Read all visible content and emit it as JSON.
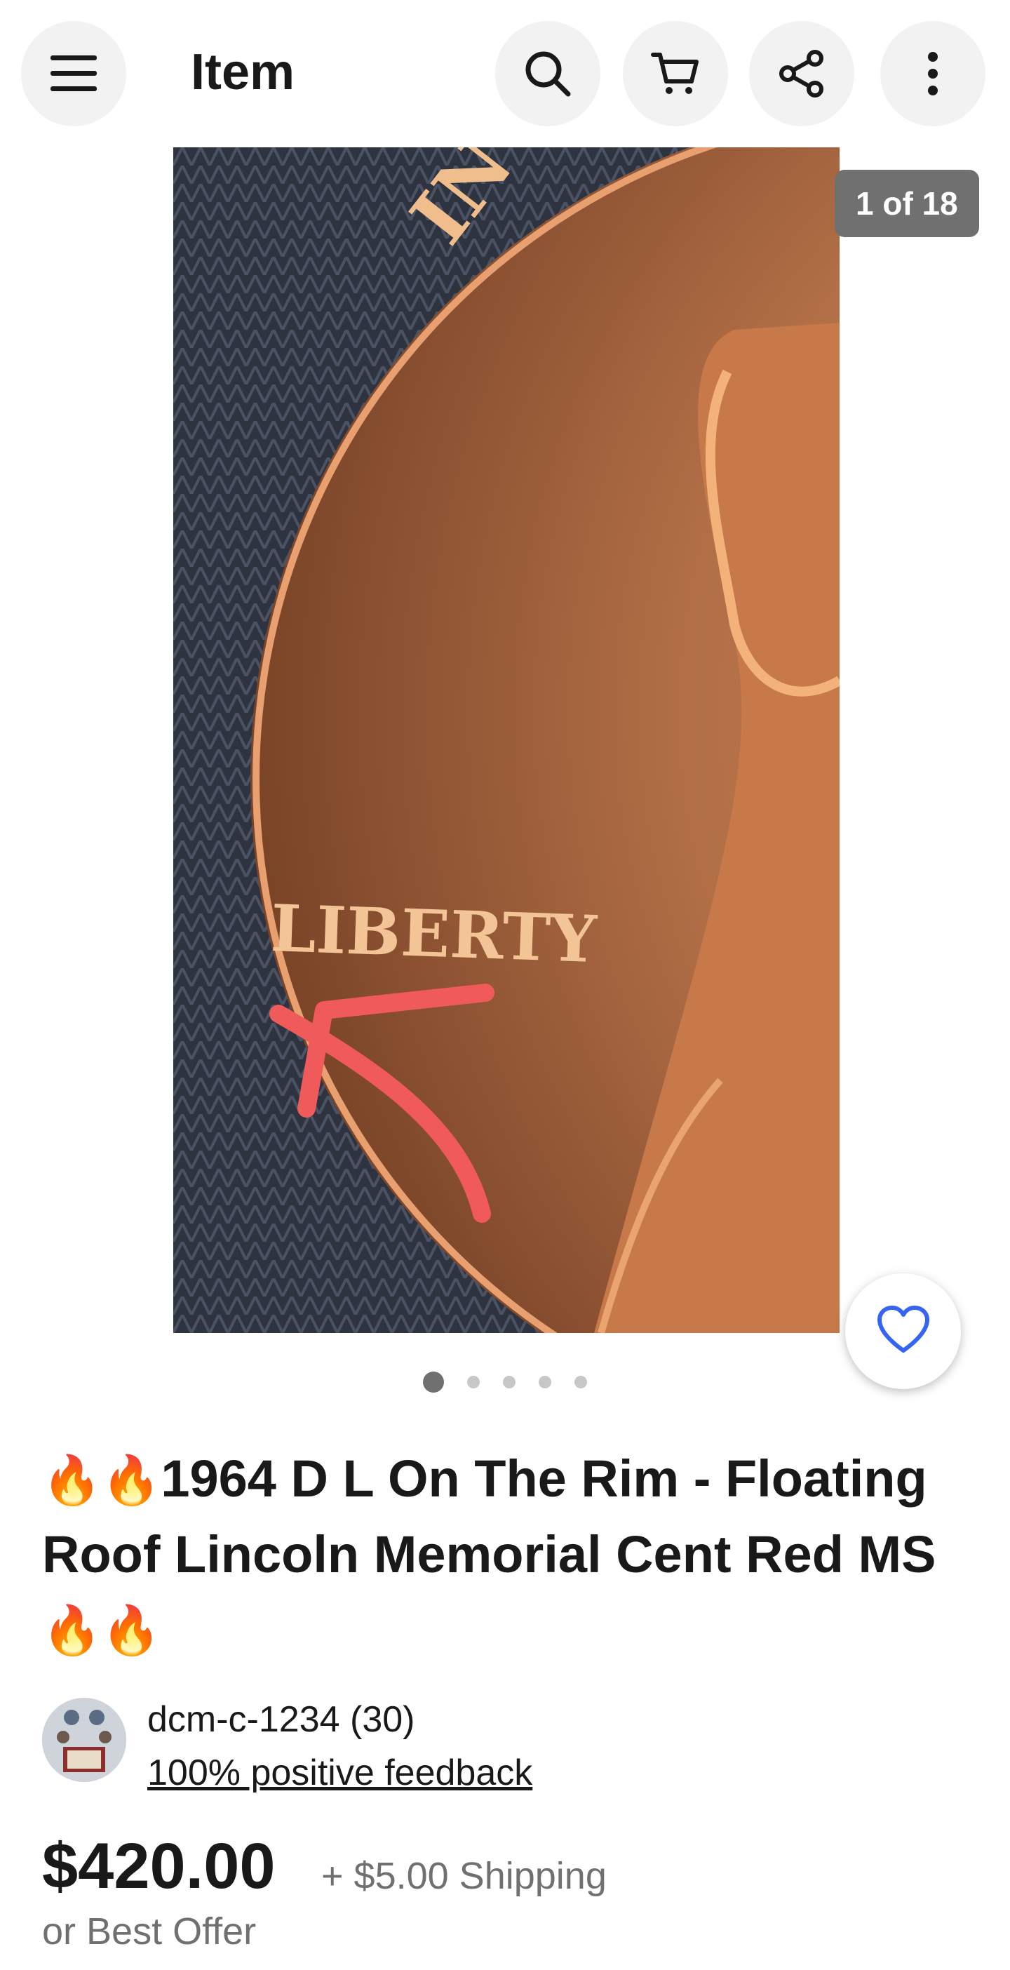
{
  "header": {
    "title": "Item",
    "icons": [
      "menu-icon",
      "search-icon",
      "cart-icon",
      "share-icon",
      "more-vertical-icon"
    ]
  },
  "gallery": {
    "counter": "1 of 18",
    "photo_text": "LIBERTY",
    "photo_rim_text": "IN GO",
    "dots_count": 5,
    "active_dot": 0,
    "watch_icon": "heart-icon",
    "accent_color": "#3665f3"
  },
  "listing": {
    "title_prefix": "🔥🔥",
    "title_text": "1964 D L On The Rim - Floating Roof Lincoln Memorial Cent Red MS",
    "title_suffix": "🔥🔥",
    "seller_name": "dcm-c-1234 (30)",
    "seller_feedback": "100% positive feedback",
    "price": "$420.00",
    "shipping": "+ $5.00 Shipping",
    "offer": "or Best Offer"
  }
}
